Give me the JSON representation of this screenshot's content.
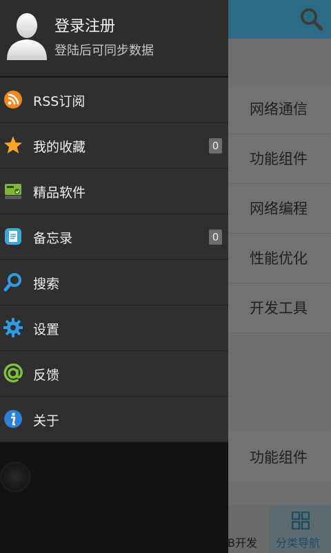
{
  "main": {
    "categories": [
      "网络通信",
      "功能组件",
      "网络编程",
      "性能优化",
      "开发工具"
    ],
    "extra_category": "功能组件",
    "bottom_tabs": [
      {
        "label": "B开发"
      },
      {
        "label": "分类导航"
      }
    ],
    "colors": {
      "topbar": "#2c6b86",
      "accent": "#1b4d63"
    }
  },
  "drawer": {
    "header": {
      "title": "登录注册",
      "subtitle": "登陆后可同步数据"
    },
    "items": [
      {
        "label": "RSS订阅",
        "icon": "rss-icon"
      },
      {
        "label": "我的收藏",
        "icon": "star-icon",
        "badge": "0"
      },
      {
        "label": "精品软件",
        "icon": "software-icon"
      },
      {
        "label": "备忘录",
        "icon": "memo-icon",
        "badge": "0"
      },
      {
        "label": "搜索",
        "icon": "search-icon"
      },
      {
        "label": "设置",
        "icon": "gear-icon"
      },
      {
        "label": "反馈",
        "icon": "at-icon"
      },
      {
        "label": "关于",
        "icon": "info-icon"
      }
    ]
  }
}
